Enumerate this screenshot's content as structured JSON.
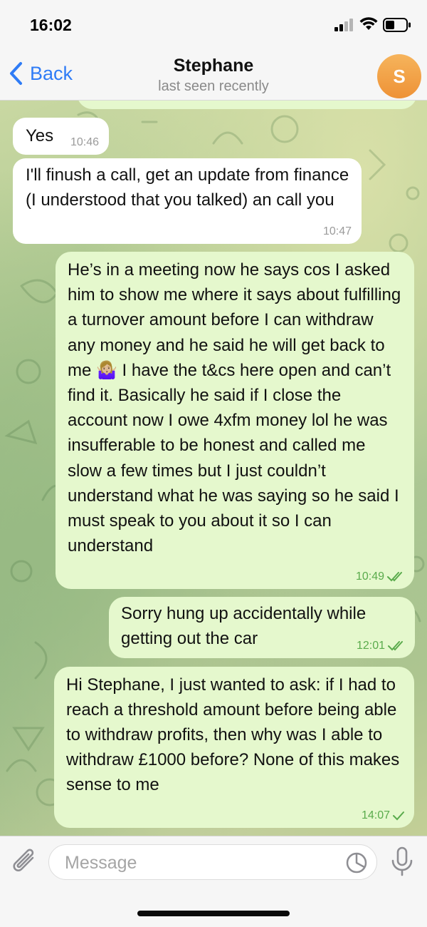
{
  "status_bar": {
    "time": "16:02"
  },
  "header": {
    "back_label": "Back",
    "contact_name": "Stephane",
    "status": "last seen recently",
    "avatar_initial": "S",
    "accent_color": "#2f7cf6"
  },
  "messages": [
    {
      "direction": "in",
      "text": "Yes",
      "time": "10:46"
    },
    {
      "direction": "in",
      "text": "I'll finush a call, get an update from finance (I understood that you talked) an call you",
      "time": "10:47"
    },
    {
      "direction": "out",
      "text": "He’s in a meeting now he says cos I asked him to show me where it says about fulfilling a turnover amount before I can withdraw any money and he said he will get back to me 🤷🏼‍♀️ I have the t&cs here open and can’t find it. Basically he said if I close the account now I owe 4xfm money lol he was insufferable to be honest and called me slow a few times but I just couldn’t understand what he was saying so he said I must speak to you about it so I can understand",
      "time": "10:49",
      "status": "read"
    },
    {
      "direction": "out",
      "text": "Sorry hung up accidentally while getting out the car",
      "time": "12:01",
      "status": "read"
    },
    {
      "direction": "out",
      "text": "Hi Stephane, I just wanted to ask: if I had to reach a threshold amount before being able to withdraw profits, then why was I able to withdraw £1000 before? None of this makes sense to me",
      "time": "14:07",
      "status": "delivered"
    }
  ],
  "composer": {
    "placeholder": "Message"
  },
  "icons": [
    "chevron-left-icon",
    "attach-icon",
    "sticker-icon",
    "microphone-icon",
    "double-check-icon",
    "single-check-icon"
  ]
}
